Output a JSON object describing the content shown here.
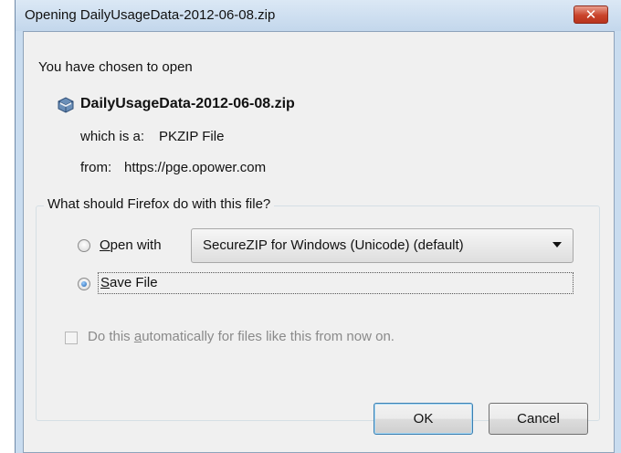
{
  "window": {
    "title": "Opening DailyUsageData-2012-06-08.zip",
    "close_glyph": "✕"
  },
  "intro_text": "You have chosen to open",
  "file": {
    "name": "DailyUsageData-2012-06-08.zip",
    "icon": "zip-package-icon",
    "type_label": "which is a:",
    "type_value": "PKZIP File",
    "from_label": "from:",
    "from_value": "https://pge.opower.com"
  },
  "action_group": {
    "legend": "What should Firefox do with this file?",
    "open_with": {
      "mnemonic": "O",
      "label_rest": "pen with",
      "selected": false
    },
    "app_select": {
      "value": "SecureZIP for Windows (Unicode) (default)"
    },
    "save_file": {
      "mnemonic": "S",
      "label_rest": "ave File",
      "selected": true
    },
    "auto_checkbox": {
      "label_before": "Do this ",
      "mnemonic": "a",
      "label_after": "utomatically for files like this from now on.",
      "checked": false,
      "enabled": false
    }
  },
  "buttons": {
    "ok": "OK",
    "cancel": "Cancel"
  }
}
